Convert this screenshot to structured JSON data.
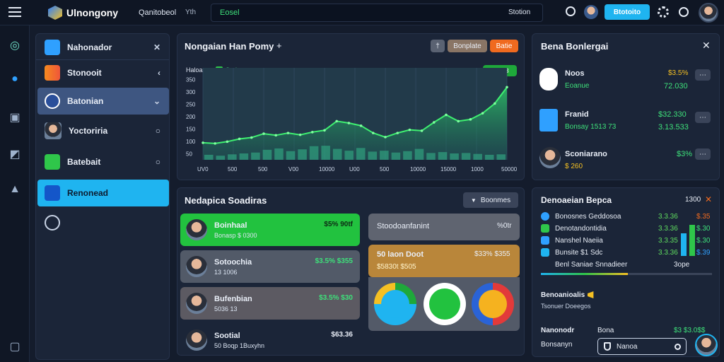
{
  "topbar": {
    "brand": "Ulnongony",
    "search_label": "Qanitobeol",
    "search_short": "Yth",
    "input_value": "Eosel",
    "input_right": "Stotion",
    "action_button": "Btotoito"
  },
  "sidebar": {
    "items": [
      {
        "label": "Nahonador",
        "tail": "✕"
      },
      {
        "label": "Stonooit",
        "tail": "‹"
      },
      {
        "label": "Batonian",
        "tail": "⌄"
      },
      {
        "label": "Yoctoriria",
        "tail": "○"
      },
      {
        "label": "Batebait",
        "tail": "○"
      },
      {
        "label": "Renonead",
        "tail": ""
      },
      {
        "label": "",
        "tail": ""
      }
    ]
  },
  "main_chart": {
    "title": "Nongaian Han Pomy",
    "plus": "+",
    "btn_a": "†",
    "btn_b": "Bonplate",
    "btn_c": "Batie",
    "legend_left": "Haloan",
    "legend_series": "Soriatent",
    "badge": "$6.8.3"
  },
  "chart_data": {
    "type": "area",
    "y_ticks": [
      "50",
      "100",
      "150",
      "200",
      "250",
      "300",
      "350"
    ],
    "x_ticks": [
      "UV0",
      "500",
      "500",
      "V00",
      "10000",
      "U00",
      "500",
      "10000",
      "15000",
      "1000",
      "50000"
    ],
    "series": [
      {
        "name": "Soriatent",
        "values": [
          75,
          72,
          80,
          92,
          98,
          115,
          108,
          118,
          110,
          122,
          130,
          170,
          162,
          150,
          118,
          100,
          118,
          132,
          128,
          165,
          198,
          170,
          178,
          205,
          248,
          320
        ]
      }
    ],
    "bars": [
      22,
      18,
      24,
      28,
      32,
      44,
      50,
      38,
      46,
      60,
      62,
      48,
      40,
      52,
      36,
      40,
      32,
      38,
      48,
      30,
      34,
      28,
      30,
      26,
      22,
      24
    ],
    "ylim": [
      0,
      380
    ]
  },
  "alerts": {
    "title": "Bena Bonlergai",
    "close": "✕",
    "rows": [
      {
        "name": "Noos",
        "sub": "Eoanue",
        "val1": "$3.5%",
        "val2": "72.030",
        "more": "⋯"
      },
      {
        "name": "Franid",
        "sub": "Bonsay 1513 73",
        "val1": "$32.330",
        "val2": "3.13.533",
        "more": "⋯"
      },
      {
        "name": "Sconiarano",
        "sub": "$ 260",
        "val1": "$3%",
        "val2": "",
        "more": "⋯"
      }
    ]
  },
  "leaders": {
    "title": "Nedapica Soadiras",
    "filter": "Boonmes",
    "rows": [
      {
        "name": "Boinhaal",
        "sub": "Bonasp $ 0300",
        "val": "$5%  90tf"
      },
      {
        "name": "Sotoochia",
        "sub": "13 1006",
        "val": "$3.5%  $355"
      },
      {
        "name": "Bufenbian",
        "sub": "5036  13",
        "val": "$3.5%  $30"
      },
      {
        "name": "Sootial",
        "sub": "50  Boqp  1Buxyhn",
        "val": "$63.36"
      }
    ],
    "right_card_a": {
      "label": "Stoodoanfanint",
      "val": "%0tr"
    },
    "right_card_b": {
      "label": "50 laon Doot",
      "sub": "$5830t  $505",
      "val": "$33%  $355"
    }
  },
  "news": {
    "title": "Denoaeian Bepca",
    "value": "1300",
    "close": "✕",
    "rows": [
      {
        "label": "Bonosnes Geddosoa",
        "v1": "3.3.36",
        "v2": "$.35"
      },
      {
        "label": "Denotandontidia",
        "v1": "3.3.36",
        "v2": "$.30"
      },
      {
        "label": "Nanshel Naeiia",
        "v1": "3.3.35",
        "v2": "$.30"
      },
      {
        "label": "Bunsite $1 Sdc",
        "v1": "3.3.36",
        "v2": "$.39"
      },
      {
        "label": "Benl Saniae Snnadieer",
        "v1": "",
        "v2": "3ope"
      }
    ],
    "footer_title": "Benoanioalis",
    "footer_sub": "Tsonuer Doeegos",
    "f_left": "Nanonodr",
    "f_left2": "Bonsanyn",
    "f_mid": "Bona",
    "f_vals": "$3  $3.0$$",
    "search": "Nanoa"
  }
}
